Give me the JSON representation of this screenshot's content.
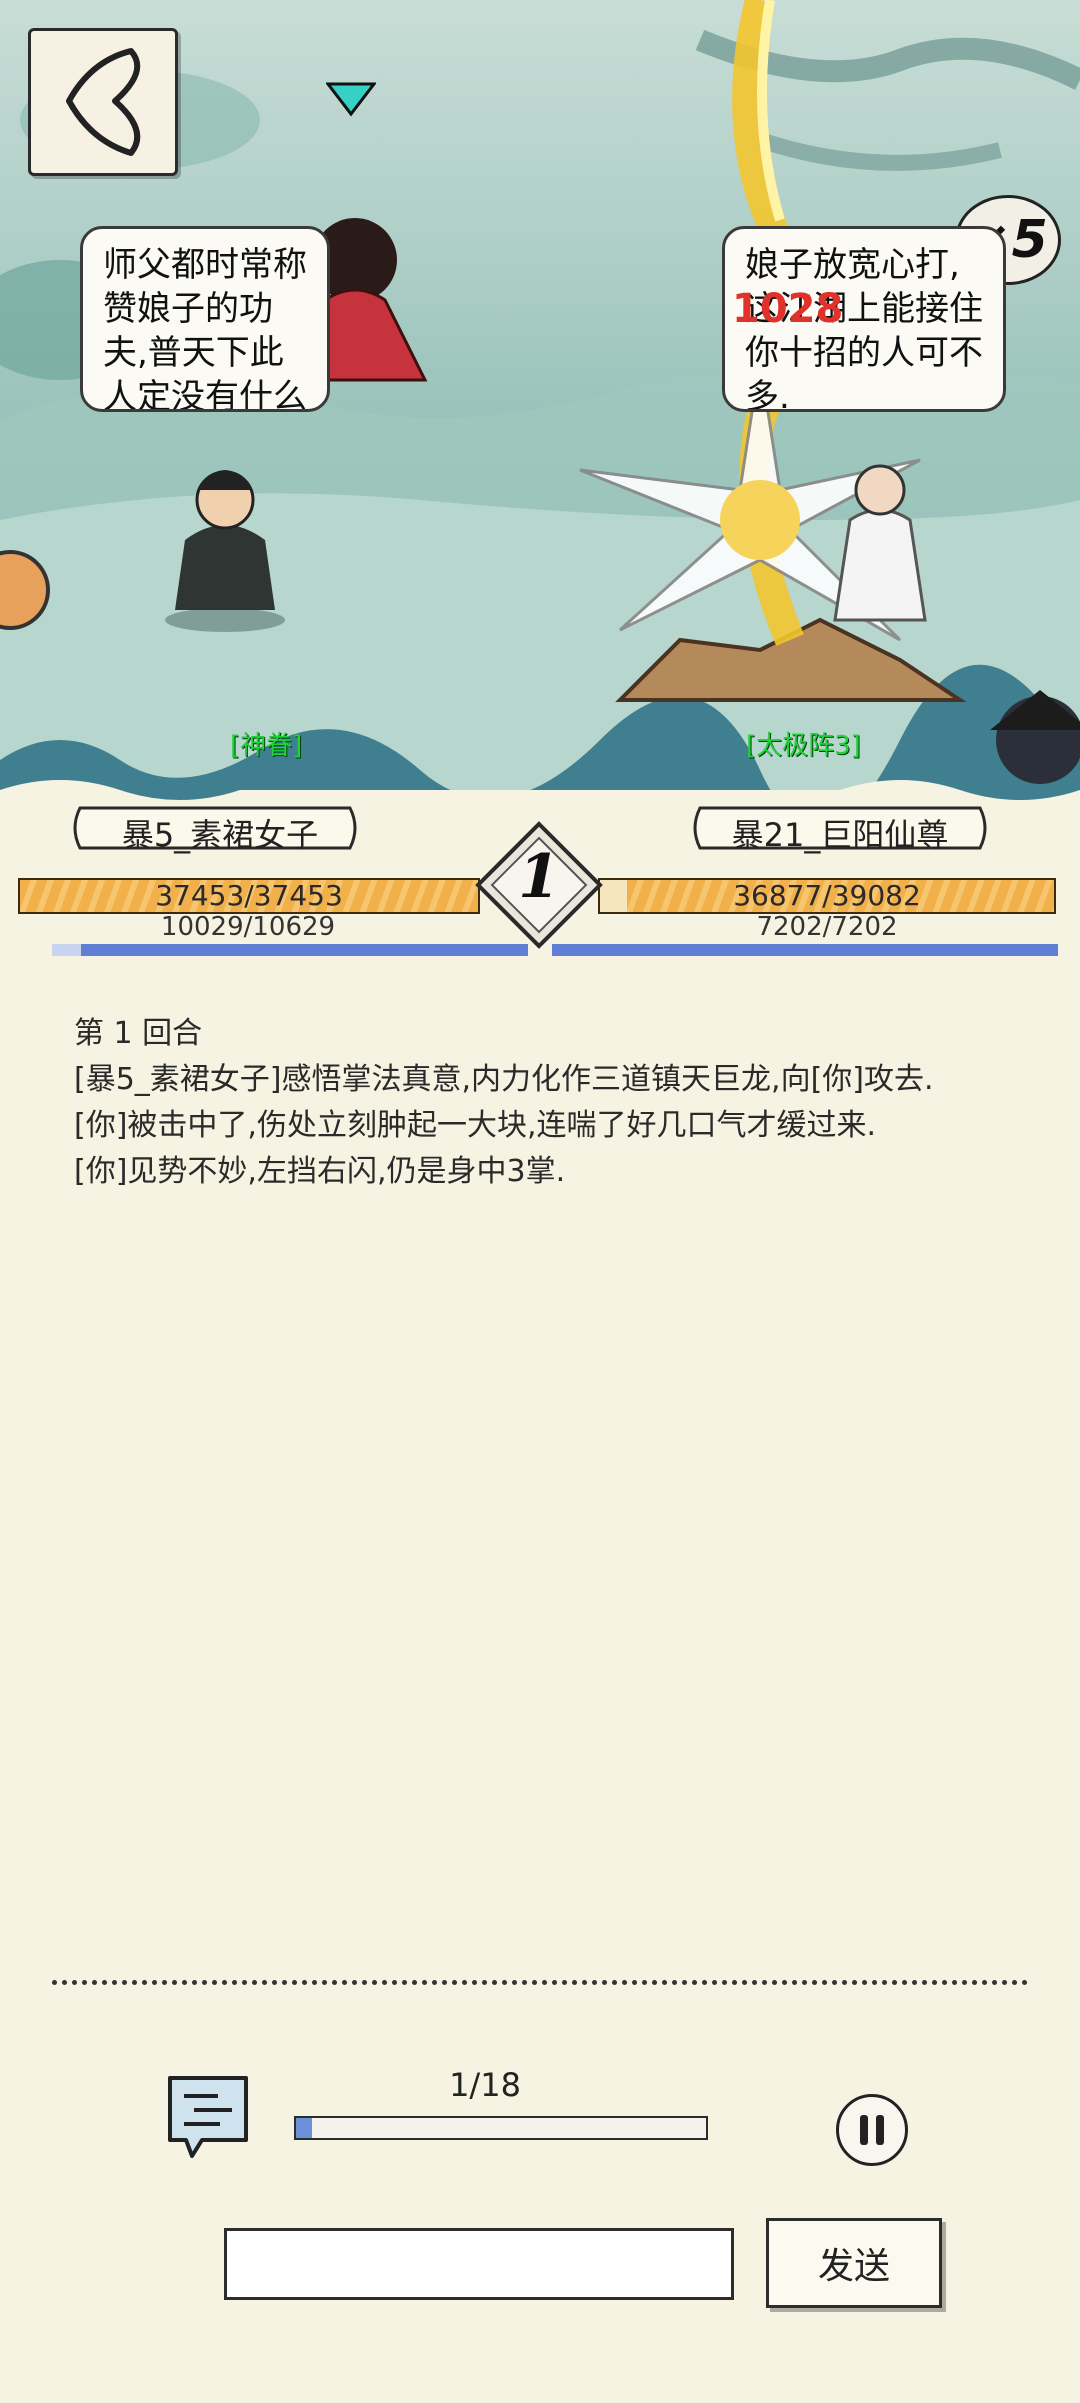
{
  "battle": {
    "speed_label": "×5",
    "left_speech": "师父都时常称赞娘子的功夫,普天下此人定没有什么问题.",
    "right_speech": "娘子放宽心打,这江湖上能接住你十招的人可不多.",
    "damage_popup": "1028",
    "left_buff": "[神眷]",
    "right_buff": "[太极阵3]",
    "round": "1"
  },
  "player": {
    "name": "暴5_素裙女子",
    "hp_text": "37453/37453",
    "hp_fraction": 1.0,
    "mp_text": "10029/10629",
    "mp_fraction": 0.94
  },
  "enemy": {
    "name": "暴21_巨阳仙尊",
    "hp_text": "36877/39082",
    "hp_fraction": 0.94,
    "mp_text": "7202/7202",
    "mp_fraction": 1.0
  },
  "log": {
    "lines": [
      "第 1 回合",
      "[暴5_素裙女子]感悟掌法真意,内力化作三道镇天巨龙,向[你]攻去.",
      "[你]被击中了,伤处立刻肿起一大块,连喘了好几口气才缓过来.",
      "[你]见势不妙,左挡右闪,仍是身中3掌."
    ]
  },
  "controls": {
    "progress_label": "1/18",
    "progress_fraction": 0.04,
    "send_label": "发送",
    "chat_placeholder": ""
  },
  "colors": {
    "hp": "#f2b04a",
    "mp": "#5f7fd4",
    "buff": "#1ed33a",
    "damage": "#e0322b"
  }
}
